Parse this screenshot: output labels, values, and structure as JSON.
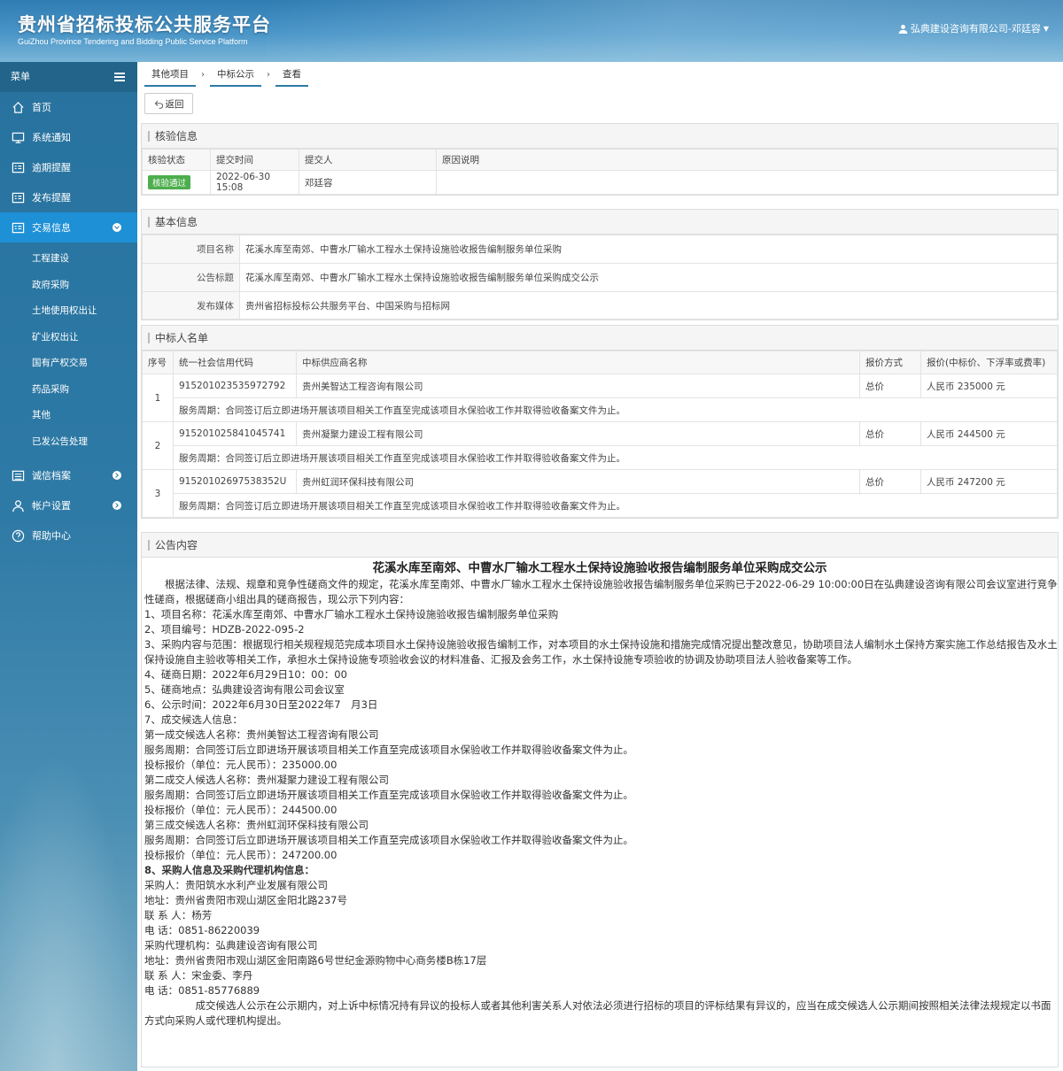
{
  "header": {
    "title": "贵州省招标投标公共服务平台",
    "subtitle": "GuiZhou Province Tendering and Bidding Public Service Platform",
    "user": "弘典建设咨询有限公司-邓廷容"
  },
  "sidebar": {
    "menu_label": "菜单",
    "items": [
      {
        "label": "首页"
      },
      {
        "label": "系统通知"
      },
      {
        "label": "逾期提醒"
      },
      {
        "label": "发布提醒"
      },
      {
        "label": "交易信息"
      },
      {
        "label": "诚信档案"
      },
      {
        "label": "帐户设置"
      },
      {
        "label": "帮助中心"
      }
    ],
    "sub_items": [
      {
        "label": "工程建设"
      },
      {
        "label": "政府采购"
      },
      {
        "label": "土地使用权出让"
      },
      {
        "label": "矿业权出让"
      },
      {
        "label": "国有产权交易"
      },
      {
        "label": "药品采购"
      },
      {
        "label": "其他"
      },
      {
        "label": "已发公告处理"
      }
    ]
  },
  "breadcrumb": [
    "其他项目",
    "中标公示",
    "查看"
  ],
  "back_label": "返回",
  "verify": {
    "title": "核验信息",
    "headers": [
      "核验状态",
      "提交时间",
      "提交人",
      "原因说明"
    ],
    "status": "核验通过",
    "time": "2022-06-30 15:08",
    "submitter": "邓廷容",
    "reason": ""
  },
  "basic": {
    "title": "基本信息",
    "rows": [
      {
        "label": "项目名称",
        "value": "花溪水库至南郊、中曹水厂输水工程水土保持设施验收报告编制服务单位采购"
      },
      {
        "label": "公告标题",
        "value": "花溪水库至南郊、中曹水厂输水工程水土保持设施验收报告编制服务单位采购成交公示"
      },
      {
        "label": "发布媒体",
        "value": "贵州省招标投标公共服务平台、中国采购与招标网"
      }
    ]
  },
  "winners": {
    "title": "中标人名单",
    "headers": [
      "序号",
      "统一社会信用代码",
      "中标供应商名称",
      "报价方式",
      "报价(中标价、下浮率或费率)"
    ],
    "rows": [
      {
        "no": "1",
        "code": "915201023535972792",
        "name": "贵州美智达工程咨询有限公司",
        "mode": "总价",
        "price": "人民币 235000 元",
        "period": "服务周期：合同签订后立即进场开展该项目相关工作直至完成该项目水保验收工作并取得验收备案文件为止。"
      },
      {
        "no": "2",
        "code": "915201025841045741",
        "name": "贵州凝聚力建设工程有限公司",
        "mode": "总价",
        "price": "人民币 244500 元",
        "period": "服务周期：合同签订后立即进场开展该项目相关工作直至完成该项目水保验收工作并取得验收备案文件为止。"
      },
      {
        "no": "3",
        "code": "91520102697538352U",
        "name": "贵州虹润环保科技有限公司",
        "mode": "总价",
        "price": "人民币 247200 元",
        "period": "服务周期：合同签订后立即进场开展该项目相关工作直至完成该项目水保验收工作并取得验收备案文件为止。"
      }
    ]
  },
  "notice": {
    "title": "公告内容",
    "heading": "花溪水库至南郊、中曹水厂输水工程水土保持设施验收报告编制服务单位采购成交公示",
    "lines": [
      {
        "text": "　　根据法律、法规、规章和竞争性磋商文件的规定，花溪水库至南郊、中曹水厂输水工程水土保持设施验收报告编制服务单位采购已于2022-06-29 10:00:00日在弘典建设咨询有限公司会议室进行竞争性磋商，根据磋商小组出具的磋商报告，现公示下列内容：",
        "wrap": true
      },
      {
        "text": "1、项目名称：花溪水库至南郊、中曹水厂输水工程水土保持设施验收报告编制服务单位采购"
      },
      {
        "text": "2、项目编号：HDZB-2022-095-2"
      },
      {
        "text": "3、采购内容与范围：根据现行相关规程规范完成本项目水土保持设施验收报告编制工作，对本项目的水土保持设施和措施完成情况提出整改意见，协助项目法人编制水土保持方案实施工作总结报告及水土保持设施自主验收等相关工作，承担水土保持设施专项验收会议的材料准备、汇报及会务工作，水土保持设施专项验收的协调及协助项目法人验收备案等工作。",
        "wrap": true
      },
      {
        "text": "4、磋商日期：2022年6月29日10：00：00"
      },
      {
        "text": "5、磋商地点：弘典建设咨询有限公司会议室"
      },
      {
        "text": "6、公示时间：2022年6月30日至2022年7　月3日"
      },
      {
        "text": "7、成交候选人信息："
      },
      {
        "text": "第一成交候选人名称：贵州美智达工程咨询有限公司"
      },
      {
        "text": "服务周期：合同签订后立即进场开展该项目相关工作直至完成该项目水保验收工作并取得验收备案文件为止。"
      },
      {
        "text": "投标报价（单位：元人民币）：235000.00"
      },
      {
        "text": "第二成交人候选人名称：贵州凝聚力建设工程有限公司"
      },
      {
        "text": "服务周期：合同签订后立即进场开展该项目相关工作直至完成该项目水保验收工作并取得验收备案文件为止。"
      },
      {
        "text": "投标报价（单位：元人民币）：244500.00"
      },
      {
        "text": "第三成交候选人名称：贵州虹润环保科技有限公司"
      },
      {
        "text": "服务周期：合同签订后立即进场开展该项目相关工作直至完成该项目水保验收工作并取得验收备案文件为止。"
      },
      {
        "text": "投标报价（单位：元人民币）：247200.00"
      },
      {
        "text": "8、采购人信息及采购代理机构信息：",
        "bold": true
      },
      {
        "text": "采购人：贵阳筑水水利产业发展有限公司"
      },
      {
        "text": "地址：贵州省贵阳市观山湖区金阳北路237号"
      },
      {
        "text": "联 系 人：杨芳"
      },
      {
        "text": "电 话：0851-86220039"
      },
      {
        "text": "采购代理机构：弘典建设咨询有限公司"
      },
      {
        "text": "地址：贵州省贵阳市观山湖区金阳南路6号世纪金源购物中心商务楼B栋17层"
      },
      {
        "text": "联 系 人：宋金委、李丹"
      },
      {
        "text": "电 话：0851-85776889"
      },
      {
        "text": "　　　　　成交候选人公示在公示期内，对上诉中标情况持有异议的投标人或者其他利害关系人对依法必须进行招标的项目的评标结果有异议的，应当在成交候选人公示期间按照相关法律法规规定以书面方式向采购人或代理机构提出。",
        "wrap": true
      }
    ]
  },
  "colors": {
    "primary": "#2e7aa6",
    "active": "#1e90d6",
    "success": "#4cae4c"
  }
}
